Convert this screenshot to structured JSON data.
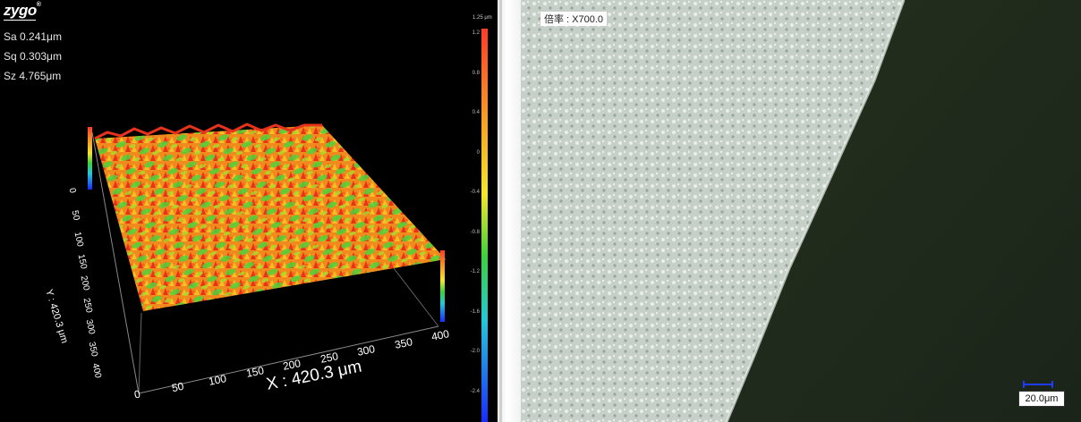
{
  "left_panel": {
    "logo": "zygo",
    "metrics": {
      "sa": "Sa 0.241μm",
      "sq": "Sq 0.303μm",
      "sz": "Sz 4.765μm"
    },
    "colorbar": {
      "title": "1.25 μm",
      "ticks": [
        "1.2",
        "0.8",
        "0.4",
        "0",
        "-0.4",
        "-0.8",
        "-1.2",
        "-1.6",
        "-2.0",
        "-2.4"
      ]
    },
    "x_axis_label": "X : 420.3 μm",
    "y_axis_label": "Y : 420.3 μm",
    "x_ticks": [
      "0",
      "50",
      "100",
      "150",
      "200",
      "250",
      "300",
      "350",
      "400"
    ],
    "y_ticks": [
      "0",
      "50",
      "100",
      "150",
      "200",
      "250",
      "300",
      "350",
      "400"
    ],
    "surface_colors": {
      "high": "#e8321c",
      "mid": "#f39c1a",
      "low": "#3cc83c"
    }
  },
  "right_panel": {
    "magnification_label": "倍率 : X700.0",
    "scale_bar_label": "20.0μm",
    "scale_bar_color": "#1f3bff",
    "background_colors": {
      "sample": "#c9d2ca",
      "void": "#1f291f"
    }
  }
}
